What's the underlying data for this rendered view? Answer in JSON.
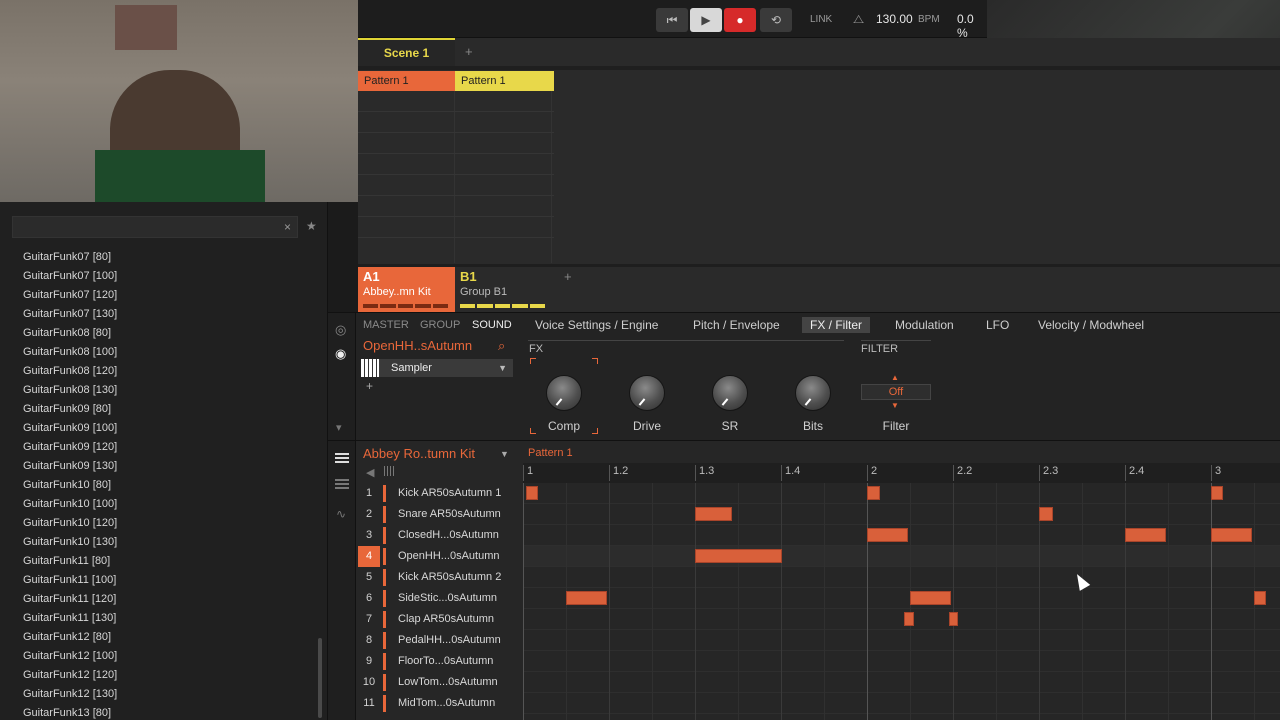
{
  "transport": {
    "link": "LINK",
    "bpm": "130.00",
    "bpm_unit": "BPM",
    "swing": "0.0 %"
  },
  "arranger": {
    "scene": "Scene 1",
    "add": "+",
    "patterns": [
      "Pattern 1",
      "Pattern 1"
    ],
    "groups": [
      {
        "id": "A1",
        "name": "Abbey..mn Kit",
        "color": "#e8673a"
      },
      {
        "id": "B1",
        "name": "Group B1",
        "color": "#e8d84a"
      }
    ]
  },
  "browser": {
    "items": [
      "GuitarFunk07 [80]",
      "GuitarFunk07 [100]",
      "GuitarFunk07 [120]",
      "GuitarFunk07 [130]",
      "GuitarFunk08 [80]",
      "GuitarFunk08 [100]",
      "GuitarFunk08 [120]",
      "GuitarFunk08 [130]",
      "GuitarFunk09 [80]",
      "GuitarFunk09 [100]",
      "GuitarFunk09 [120]",
      "GuitarFunk09 [130]",
      "GuitarFunk10 [80]",
      "GuitarFunk10 [100]",
      "GuitarFunk10 [120]",
      "GuitarFunk10 [130]",
      "GuitarFunk11 [80]",
      "GuitarFunk11 [100]",
      "GuitarFunk11 [120]",
      "GuitarFunk11 [130]",
      "GuitarFunk12 [80]",
      "GuitarFunk12 [100]",
      "GuitarFunk12 [120]",
      "GuitarFunk12 [130]",
      "GuitarFunk13 [80]"
    ]
  },
  "control": {
    "master": "MASTER",
    "group": "GROUP",
    "sound": "SOUND",
    "sound_name": "OpenHH..sAutumn",
    "plugin": "Sampler",
    "tabs": [
      "Voice Settings / Engine",
      "Pitch / Envelope",
      "FX / Filter",
      "Modulation",
      "LFO",
      "Velocity / Modwheel"
    ],
    "fx_title": "FX",
    "filter_title": "FILTER",
    "knobs": [
      "Comp",
      "Drive",
      "SR",
      "Bits"
    ],
    "filter_value": "Off",
    "filter_label": "Filter"
  },
  "pattern": {
    "kit": "Abbey Ro..tumn Kit",
    "name": "Pattern 1",
    "ticks": [
      "1",
      "1.2",
      "1.3",
      "1.4",
      "2",
      "2.2",
      "2.3",
      "2.4",
      "3"
    ],
    "sounds": [
      "Kick AR50sAutumn 1",
      "Snare AR50sAutumn",
      "ClosedH...0sAutumn",
      "OpenHH...0sAutumn",
      "Kick AR50sAutumn 2",
      "SideStic...0sAutumn",
      "Clap AR50sAutumn",
      "PedalHH...0sAutumn",
      "FloorTo...0sAutumn",
      "LowTom...0sAutumn",
      "MidTom...0sAutumn"
    ],
    "selected": 4
  }
}
